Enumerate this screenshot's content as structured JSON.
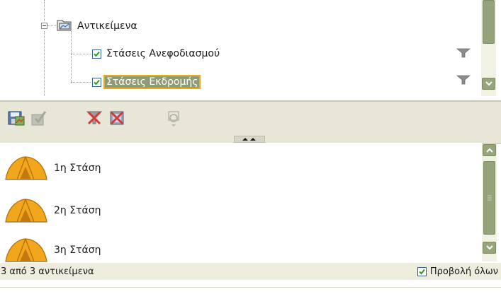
{
  "tree": {
    "root": {
      "label": "Αντικείμενα",
      "icon": "layers-folder-icon",
      "expanded": true
    },
    "items": [
      {
        "label": "Στάσεις Ανεφοδιασμού",
        "checked": true,
        "selected": false,
        "icon": "filter-icon"
      },
      {
        "label": "Στάσεις Εκδρομής",
        "checked": true,
        "selected": true,
        "icon": "filter-icon"
      }
    ]
  },
  "toolbar": {
    "buttons": [
      {
        "name": "save-map-icon",
        "enabled": true
      },
      {
        "name": "edit-checklist-icon",
        "enabled": false
      },
      {
        "name": "clear-filter-icon",
        "enabled": true
      },
      {
        "name": "delete-icon",
        "enabled": true
      },
      {
        "name": "zoom-to-icon",
        "enabled": false
      }
    ]
  },
  "list": {
    "items": [
      {
        "label": "1η Στάση",
        "icon": "tent-icon"
      },
      {
        "label": "2η Στάση",
        "icon": "tent-icon"
      },
      {
        "label": "3η Στάση",
        "icon": "tent-icon"
      }
    ]
  },
  "status": {
    "count_text": "3 από 3 αντικείμενα",
    "show_all_label": "Προβολή όλων",
    "show_all_checked": true
  },
  "colors": {
    "accent": "#95a37a",
    "selection_bg": "#8f9b74",
    "selection_border": "#e3ad1c",
    "toolbar_bg": "#e7e6d7",
    "check": "#2a9a1a"
  }
}
